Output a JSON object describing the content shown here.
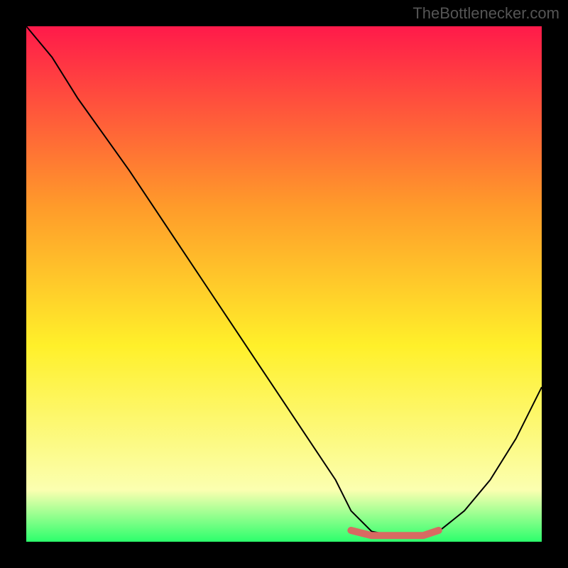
{
  "watermark": "TheBottlenecker.com",
  "chart_data": {
    "type": "line",
    "title": "",
    "xlabel": "",
    "ylabel": "",
    "xlim": [
      0,
      100
    ],
    "ylim": [
      0,
      100
    ],
    "background_gradient": {
      "top": "#ff1a4a",
      "mid_upper": "#ff9b2a",
      "mid": "#fff02a",
      "lower": "#fbffb0",
      "bottom": "#2cff6c"
    },
    "series": [
      {
        "name": "bottleneck-curve",
        "color": "#000000",
        "x": [
          0,
          5,
          10,
          15,
          20,
          25,
          30,
          35,
          40,
          45,
          50,
          55,
          60,
          63,
          67,
          72,
          77,
          80,
          85,
          90,
          95,
          100
        ],
        "y": [
          100,
          94,
          86,
          79,
          72,
          64.5,
          57,
          49.5,
          42,
          34.5,
          27,
          19.5,
          12,
          6,
          2,
          1,
          1,
          2,
          6,
          12,
          20,
          30
        ]
      },
      {
        "name": "highlight-segment",
        "color": "#d86a62",
        "x": [
          63,
          67,
          72,
          77,
          80
        ],
        "y": [
          2.2,
          1.2,
          1.2,
          1.2,
          2.2
        ]
      }
    ]
  }
}
